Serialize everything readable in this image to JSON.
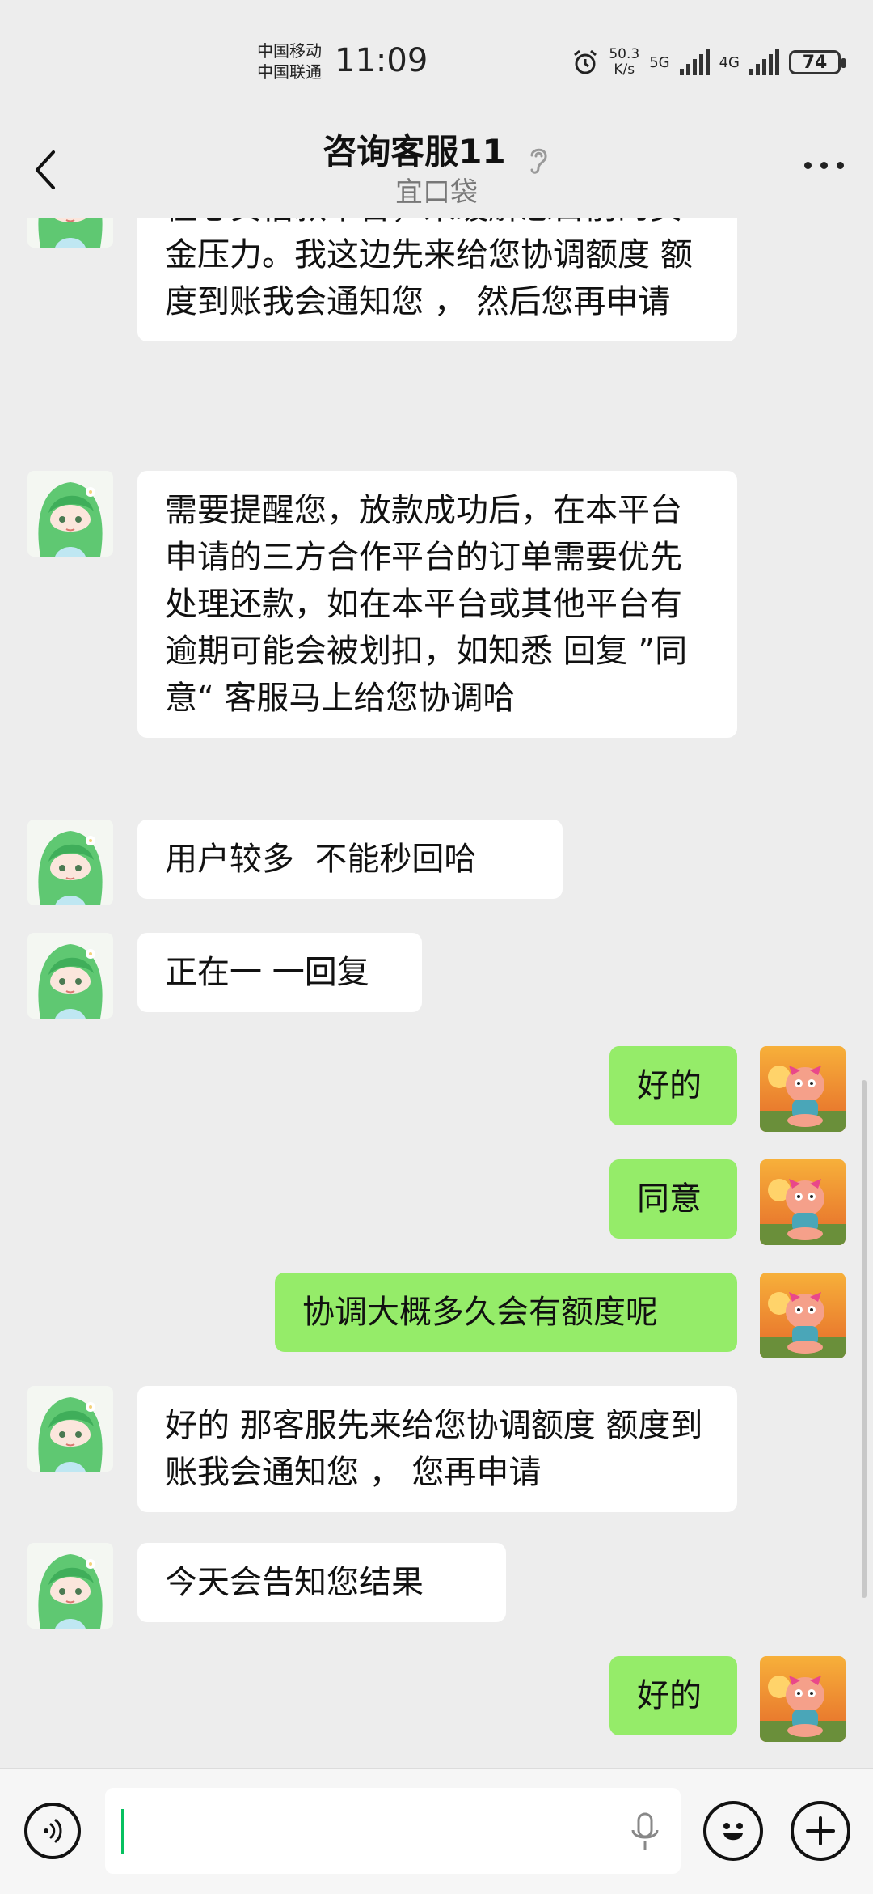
{
  "status_bar": {
    "carrier_1": "中国移动",
    "carrier_2": "中国联通",
    "time": "11:09",
    "net_speed_value": "50.3",
    "net_speed_unit": "K/s",
    "sig1_label": "5G",
    "sig2_label": "4G",
    "battery": "74"
  },
  "header": {
    "title": "咨询客服11",
    "subtitle": "宜口袋"
  },
  "messages": [
    {
      "side": "in",
      "text": "根据您目前的情况，客服给您匹配了橙心贷借款平台，来缓解您目前的资金压力。我这边先来给您协调额度 额度到账我会通知您 ， 然后您再申请"
    },
    {
      "side": "in",
      "text": "需要提醒您，放款成功后，在本平台申请的三方合作平台的订单需要优先处理还款，如在本平台或其他平台有逾期可能会被划扣，如知悉 回复 ”同意“ 客服马上给您协调哈"
    },
    {
      "side": "in",
      "text": "用户较多  不能秒回哈"
    },
    {
      "side": "in",
      "text": "正在一 一回复"
    },
    {
      "side": "out",
      "text": "好的"
    },
    {
      "side": "out",
      "text": "同意"
    },
    {
      "side": "out",
      "text": "协调大概多久会有额度呢"
    },
    {
      "side": "in",
      "text": "好的 那客服先来给您协调额度 额度到账我会通知您 ， 您再申请"
    },
    {
      "side": "in",
      "text": "今天会告知您结果"
    },
    {
      "side": "out",
      "text": "好的"
    }
  ],
  "colors": {
    "background": "#ededed",
    "incoming_bubble": "#ffffff",
    "outgoing_bubble": "#95ec69",
    "caret": "#07c160"
  },
  "icons": {
    "back": "chevron-left-icon",
    "ear": "ear-icon",
    "more": "more-icon",
    "voice": "voice-icon",
    "mic": "mic-icon",
    "emoji": "emoji-icon",
    "add": "plus-icon"
  }
}
